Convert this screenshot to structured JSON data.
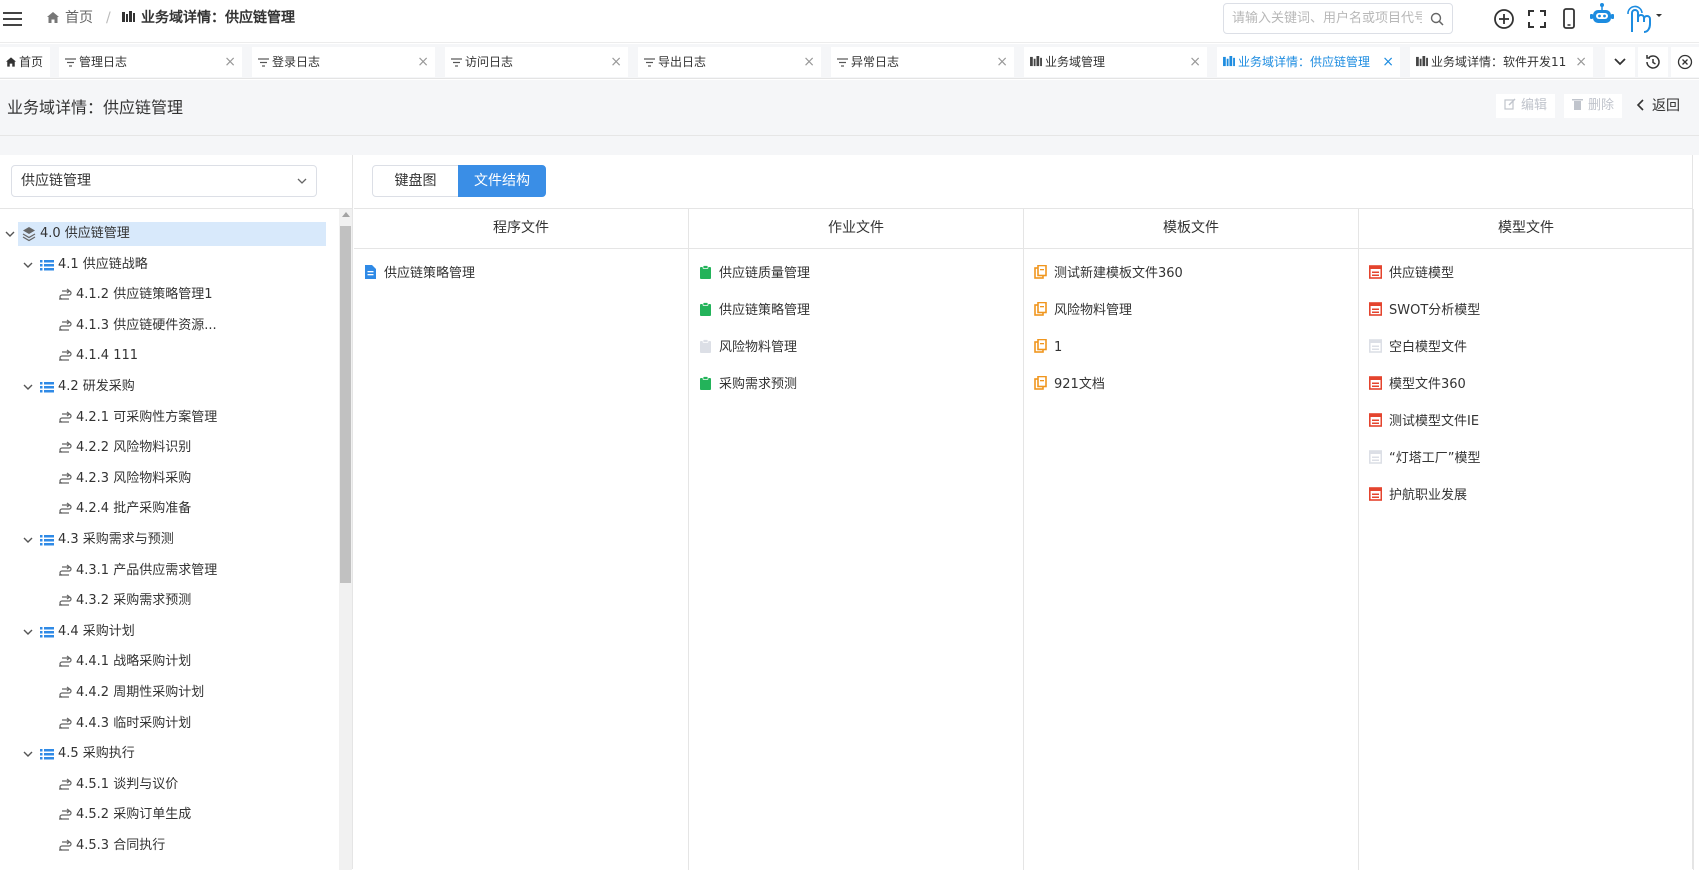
{
  "topbar": {
    "breadcrumb_home": "首页",
    "breadcrumb_sep": "/",
    "breadcrumb_current": "业务域详情：供应链管理",
    "search_placeholder": "请输入关键词、用户名或项目代号"
  },
  "tabs": [
    {
      "label": "首页",
      "icon": "home-icon",
      "active": false,
      "closable": false
    },
    {
      "label": "管理日志",
      "icon": "filter-icon",
      "active": false,
      "closable": true
    },
    {
      "label": "登录日志",
      "icon": "filter-icon",
      "active": false,
      "closable": true
    },
    {
      "label": "访问日志",
      "icon": "filter-icon",
      "active": false,
      "closable": true
    },
    {
      "label": "导出日志",
      "icon": "filter-icon",
      "active": false,
      "closable": true
    },
    {
      "label": "异常日志",
      "icon": "filter-icon",
      "active": false,
      "closable": true
    },
    {
      "label": "业务域管理",
      "icon": "domain-icon",
      "active": false,
      "closable": true
    },
    {
      "label": "业务域详情：供应链管理",
      "icon": "domain-icon",
      "active": true,
      "closable": true
    },
    {
      "label": "业务域详情：软件开发11",
      "icon": "domain-icon",
      "active": false,
      "closable": true
    }
  ],
  "page_header": {
    "title": "业务域详情：供应链管理",
    "edit_label": "编辑",
    "delete_label": "删除",
    "back_label": "返回"
  },
  "left": {
    "select_value": "供应链管理",
    "tree": [
      {
        "label": "4.0 供应链管理",
        "level": 0,
        "icon": "layers-icon",
        "expanded": true,
        "selected": true
      },
      {
        "label": "4.1 供应链战略",
        "level": 1,
        "icon": "list-icon",
        "expanded": true
      },
      {
        "label": "4.1.2 供应链策略管理1",
        "level": 2,
        "icon": "process-icon"
      },
      {
        "label": "4.1.3 供应链硬件资源...",
        "level": 2,
        "icon": "process-icon"
      },
      {
        "label": "4.1.4 111",
        "level": 2,
        "icon": "process-icon"
      },
      {
        "label": "4.2 研发采购",
        "level": 1,
        "icon": "list-icon",
        "expanded": true
      },
      {
        "label": "4.2.1 可采购性方案管理",
        "level": 2,
        "icon": "process-icon"
      },
      {
        "label": "4.2.2 风险物料识别",
        "level": 2,
        "icon": "process-icon"
      },
      {
        "label": "4.2.3 风险物料采购",
        "level": 2,
        "icon": "process-icon"
      },
      {
        "label": "4.2.4 批产采购准备",
        "level": 2,
        "icon": "process-icon"
      },
      {
        "label": "4.3 采购需求与预测",
        "level": 1,
        "icon": "list-icon",
        "expanded": true
      },
      {
        "label": "4.3.1 产品供应需求管理",
        "level": 2,
        "icon": "process-icon"
      },
      {
        "label": "4.3.2 采购需求预测",
        "level": 2,
        "icon": "process-icon"
      },
      {
        "label": "4.4 采购计划",
        "level": 1,
        "icon": "list-icon",
        "expanded": true
      },
      {
        "label": "4.4.1 战略采购计划",
        "level": 2,
        "icon": "process-icon"
      },
      {
        "label": "4.4.2 周期性采购计划",
        "level": 2,
        "icon": "process-icon"
      },
      {
        "label": "4.4.3 临时采购计划",
        "level": 2,
        "icon": "process-icon"
      },
      {
        "label": "4.5 采购执行",
        "level": 1,
        "icon": "list-icon",
        "expanded": true
      },
      {
        "label": "4.5.1 谈判与议价",
        "level": 2,
        "icon": "process-icon"
      },
      {
        "label": "4.5.2 采购订单生成",
        "level": 2,
        "icon": "process-icon"
      },
      {
        "label": "4.5.3 合同执行",
        "level": 2,
        "icon": "process-icon"
      }
    ]
  },
  "right": {
    "view_tabs": [
      "键盘图",
      "文件结构"
    ],
    "active_view": "文件结构",
    "columns": [
      {
        "title": "程序文件",
        "icon": "doc-icon",
        "color": "#2f8ae6",
        "items": [
          {
            "label": "供应链策略管理",
            "disabled": false
          }
        ]
      },
      {
        "title": "作业文件",
        "icon": "clipboard-icon",
        "color": "#23b35a",
        "items": [
          {
            "label": "供应链质量管理",
            "disabled": false
          },
          {
            "label": "供应链策略管理",
            "disabled": false
          },
          {
            "label": "风险物料管理",
            "disabled": true
          },
          {
            "label": "采购需求预测",
            "disabled": false
          }
        ]
      },
      {
        "title": "模板文件",
        "icon": "template-icon",
        "color": "#f0961e",
        "items": [
          {
            "label": "测试新建模板文件360",
            "disabled": false
          },
          {
            "label": "风险物料管理",
            "disabled": false
          },
          {
            "label": "1",
            "disabled": false
          },
          {
            "label": "921文档",
            "disabled": false
          }
        ]
      },
      {
        "title": "模型文件",
        "icon": "model-icon",
        "color": "#e4442e",
        "items": [
          {
            "label": "供应链模型",
            "disabled": false
          },
          {
            "label": "SWOT分析模型",
            "disabled": false
          },
          {
            "label": "空白模型文件",
            "disabled": true
          },
          {
            "label": "模型文件360",
            "disabled": false
          },
          {
            "label": "测试模型文件IE",
            "disabled": false
          },
          {
            "label": "“灯塔工厂”模型",
            "disabled": true
          },
          {
            "label": "护航职业发展",
            "disabled": false
          }
        ]
      }
    ]
  }
}
